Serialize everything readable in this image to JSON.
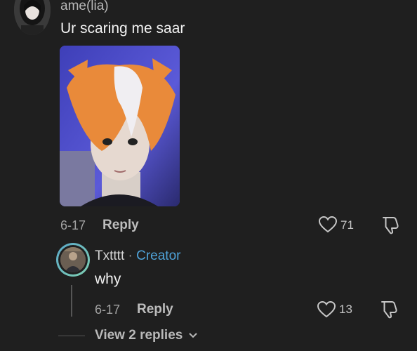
{
  "comment": {
    "username": "ame(lia)",
    "text": "Ur scaring me saar",
    "date": "6-17",
    "reply_label": "Reply",
    "like_count": "71"
  },
  "reply": {
    "username": "Txtttt",
    "separator": "·",
    "badge": "Creator",
    "text": "why",
    "date": "6-17",
    "reply_label": "Reply",
    "like_count": "13"
  },
  "view_replies": {
    "label": "View 2 replies"
  },
  "icons": {
    "like": "heart-icon",
    "dislike": "thumbs-down-icon",
    "expand": "chevron-down-icon"
  },
  "colors": {
    "background": "#1f1f1f",
    "creator_badge": "#4fa3d9"
  }
}
